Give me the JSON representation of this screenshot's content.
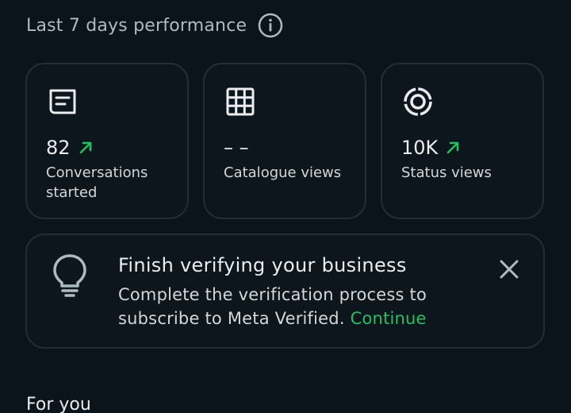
{
  "performance": {
    "title": "Last 7 days performance",
    "info_icon": "info-icon"
  },
  "stats": [
    {
      "icon": "conversation-icon",
      "value": "82",
      "trend": "up",
      "label": "Conversations started"
    },
    {
      "icon": "catalogue-grid-icon",
      "value": "– –",
      "trend": "none",
      "label": "Catalogue views"
    },
    {
      "icon": "status-ring-icon",
      "value": "10K",
      "trend": "up",
      "label": "Status views"
    }
  ],
  "verification": {
    "icon": "lightbulb-icon",
    "title": "Finish verifying your business",
    "body": "Complete the verification process to subscribe to Meta Verified.",
    "link": "Continue",
    "close_icon": "close-icon"
  },
  "for_you": {
    "title": "For you"
  },
  "colors": {
    "background": "#0b141a",
    "card_border": "#222d34",
    "accent_green": "#21c063",
    "muted_text": "#aebac1"
  }
}
